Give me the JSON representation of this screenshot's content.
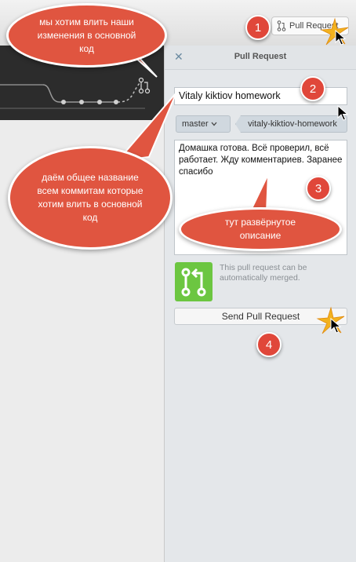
{
  "toolbar": {
    "pull_request_label": "Pull Request"
  },
  "panel": {
    "title": "Pull Request",
    "close_glyph": "✕",
    "title_value": "Vitaly kiktiov homework",
    "base_branch": "master",
    "head_branch": "vitaly-kiktiov-homework",
    "description": "Домашка готова. Всё проверил, всё работает. Жду комментариев. Заранее спасибо",
    "merge_status": "This pull request can be automatically merged.",
    "send_label": "Send Pull Request"
  },
  "annotations": {
    "bubble_top": "мы хотим влить наши изменения в основной код",
    "bubble_left": "даём общее название всем коммитам которые хотим влить в основной код",
    "bubble_description": "тут развёрнутое описание",
    "steps": [
      "1",
      "2",
      "3",
      "4"
    ]
  },
  "colors": {
    "accent_red": "#e0473a",
    "merge_green": "#6cc641",
    "panel_bg": "#e4e7ea"
  },
  "icons": [
    "pull-request-icon",
    "close-icon",
    "chevron-down-icon",
    "merge-icon",
    "cursor-icon",
    "sparkle-icon"
  ]
}
